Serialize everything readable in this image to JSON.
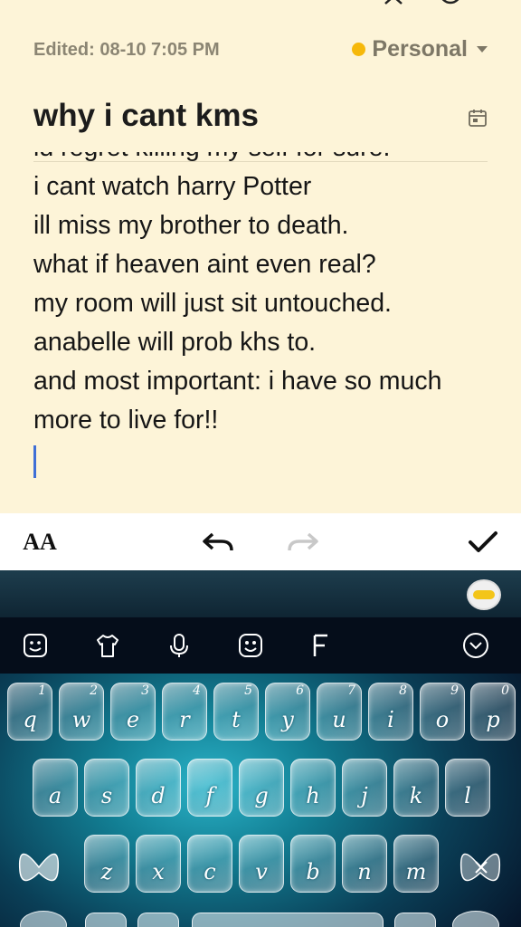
{
  "meta": {
    "edited": "Edited: 08-10 7:05 PM",
    "category": "Personal",
    "category_color": "#f6b80a"
  },
  "note": {
    "title": "why i cant kms",
    "lines": [
      "id regret killing my self for sure.",
      "i cant watch harry Potter",
      "ill miss my brother to death.",
      "what if heaven aint even real?",
      "my room will just sit untouched.",
      "anabelle will prob khs to.",
      "and most important: i have so much",
      "more to live for!!"
    ]
  },
  "toolbar": {
    "format_label": "AA",
    "icons": [
      "text-format-icon",
      "undo-icon",
      "redo-icon",
      "check-icon"
    ]
  },
  "keyboard": {
    "row1": [
      {
        "letter": "q",
        "num": "1"
      },
      {
        "letter": "w",
        "num": "2"
      },
      {
        "letter": "e",
        "num": "3"
      },
      {
        "letter": "r",
        "num": "4"
      },
      {
        "letter": "t",
        "num": "5"
      },
      {
        "letter": "y",
        "num": "6"
      },
      {
        "letter": "u",
        "num": "7"
      },
      {
        "letter": "i",
        "num": "8"
      },
      {
        "letter": "o",
        "num": "9"
      },
      {
        "letter": "p",
        "num": "0"
      }
    ],
    "row2": [
      "a",
      "s",
      "d",
      "f",
      "g",
      "h",
      "j",
      "k",
      "l"
    ],
    "row3": [
      "z",
      "x",
      "c",
      "v",
      "b",
      "n",
      "m"
    ],
    "tool_icons": [
      "sticker-icon",
      "theme-shirt-icon",
      "microphone-icon",
      "emoji-icon",
      "font-icon",
      "collapse-chevron-icon"
    ]
  }
}
